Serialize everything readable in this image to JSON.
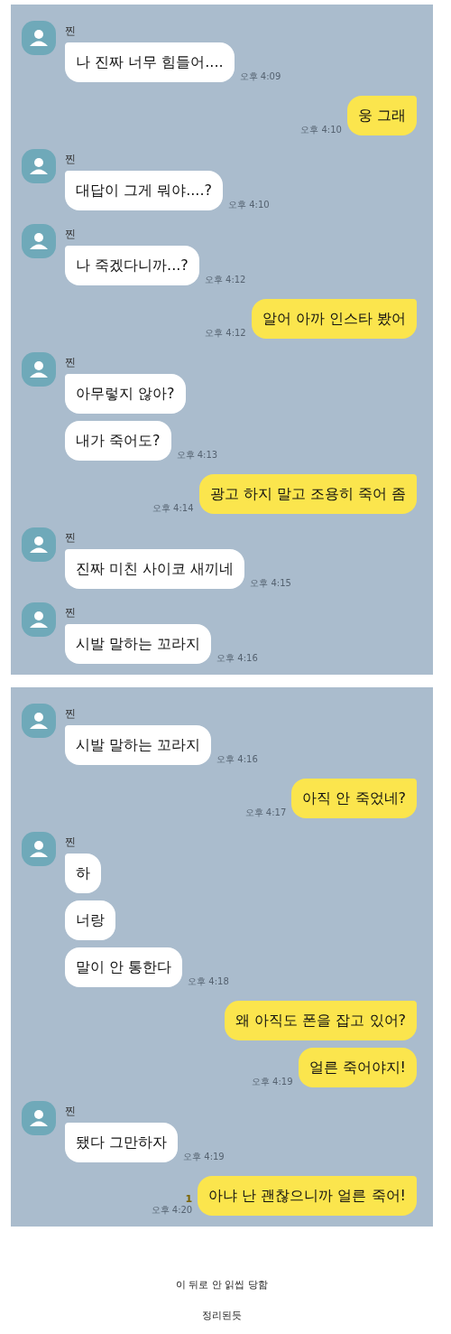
{
  "panels": [
    {
      "groups": [
        {
          "kind": "incoming",
          "sender": "찐",
          "bubbles": [
            "나 진짜 너무 힘들어...."
          ],
          "time": "오후 4:09"
        },
        {
          "kind": "outgoing",
          "bubbles": [
            "웅 그래"
          ],
          "time": "오후 4:10"
        },
        {
          "kind": "incoming",
          "sender": "찐",
          "bubbles": [
            "대답이 그게 뭐야....?"
          ],
          "time": "오후 4:10"
        },
        {
          "kind": "incoming",
          "sender": "찐",
          "bubbles": [
            "나 죽겠다니까...?"
          ],
          "time": "오후 4:12"
        },
        {
          "kind": "outgoing",
          "bubbles": [
            "알어 아까 인스타 봤어"
          ],
          "time": "오후 4:12"
        },
        {
          "kind": "incoming",
          "sender": "찐",
          "bubbles": [
            "아무렇지 않아?",
            "내가 죽어도?"
          ],
          "time": "오후 4:13"
        },
        {
          "kind": "outgoing",
          "bubbles": [
            "광고 하지 말고 조용히 죽어 좀"
          ],
          "time": "오후 4:14"
        },
        {
          "kind": "incoming",
          "sender": "찐",
          "bubbles": [
            "진짜 미친 사이코 새끼네"
          ],
          "time": "오후 4:15"
        },
        {
          "kind": "incoming",
          "sender": "찐",
          "bubbles": [
            "시발 말하는 꼬라지"
          ],
          "time": "오후 4:16"
        }
      ]
    },
    {
      "groups": [
        {
          "kind": "incoming",
          "sender": "찐",
          "bubbles": [
            "시발 말하는 꼬라지"
          ],
          "time": "오후 4:16"
        },
        {
          "kind": "outgoing",
          "bubbles": [
            "아직 안 죽었네?"
          ],
          "time": "오후 4:17"
        },
        {
          "kind": "incoming",
          "sender": "찐",
          "bubbles": [
            "하",
            "너랑",
            "말이 안 통한다"
          ],
          "time": "오후 4:18"
        },
        {
          "kind": "outgoing",
          "bubbles": [
            "왜 아직도 폰을 잡고 있어?",
            "얼른 죽어야지!"
          ],
          "time": "오후 4:19"
        },
        {
          "kind": "incoming",
          "sender": "찐",
          "bubbles": [
            "됐다 그만하자"
          ],
          "time": "오후 4:19"
        },
        {
          "kind": "outgoing",
          "bubbles": [
            "아냐 난 괜찮으니까 얼른 죽어!"
          ],
          "unread": "1",
          "time": "오후 4:20"
        }
      ]
    }
  ],
  "captions": [
    "이 뒤로 안 읽씹 당함",
    "정리된듯"
  ]
}
